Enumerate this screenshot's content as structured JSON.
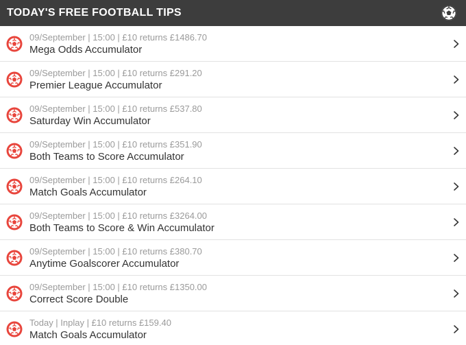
{
  "header": {
    "title": "TODAY'S FREE FOOTBALL TIPS",
    "icon": "football-icon"
  },
  "colors": {
    "header_bg": "#3d3d3d",
    "ball_red": "#e8453c",
    "meta_text": "#9a9a9a",
    "title_text": "#333333"
  },
  "tips": [
    {
      "meta": "09/September | 15:00 | £10 returns £1486.70",
      "title": "Mega Odds Accumulator"
    },
    {
      "meta": "09/September | 15:00 | £10 returns £291.20",
      "title": "Premier League Accumulator"
    },
    {
      "meta": "09/September | 15:00 | £10 returns £537.80",
      "title": "Saturday Win Accumulator"
    },
    {
      "meta": "09/September | 15:00 | £10 returns £351.90",
      "title": "Both Teams to Score Accumulator"
    },
    {
      "meta": "09/September | 15:00 | £10 returns £264.10",
      "title": "Match Goals Accumulator"
    },
    {
      "meta": "09/September | 15:00 | £10 returns £3264.00",
      "title": "Both Teams to Score & Win Accumulator"
    },
    {
      "meta": "09/September | 15:00 | £10 returns £380.70",
      "title": "Anytime Goalscorer Accumulator"
    },
    {
      "meta": "09/September | 15:00 | £10 returns £1350.00",
      "title": "Correct Score Double"
    },
    {
      "meta": "Today | Inplay | £10 returns £159.40",
      "title": "Match Goals Accumulator"
    }
  ]
}
